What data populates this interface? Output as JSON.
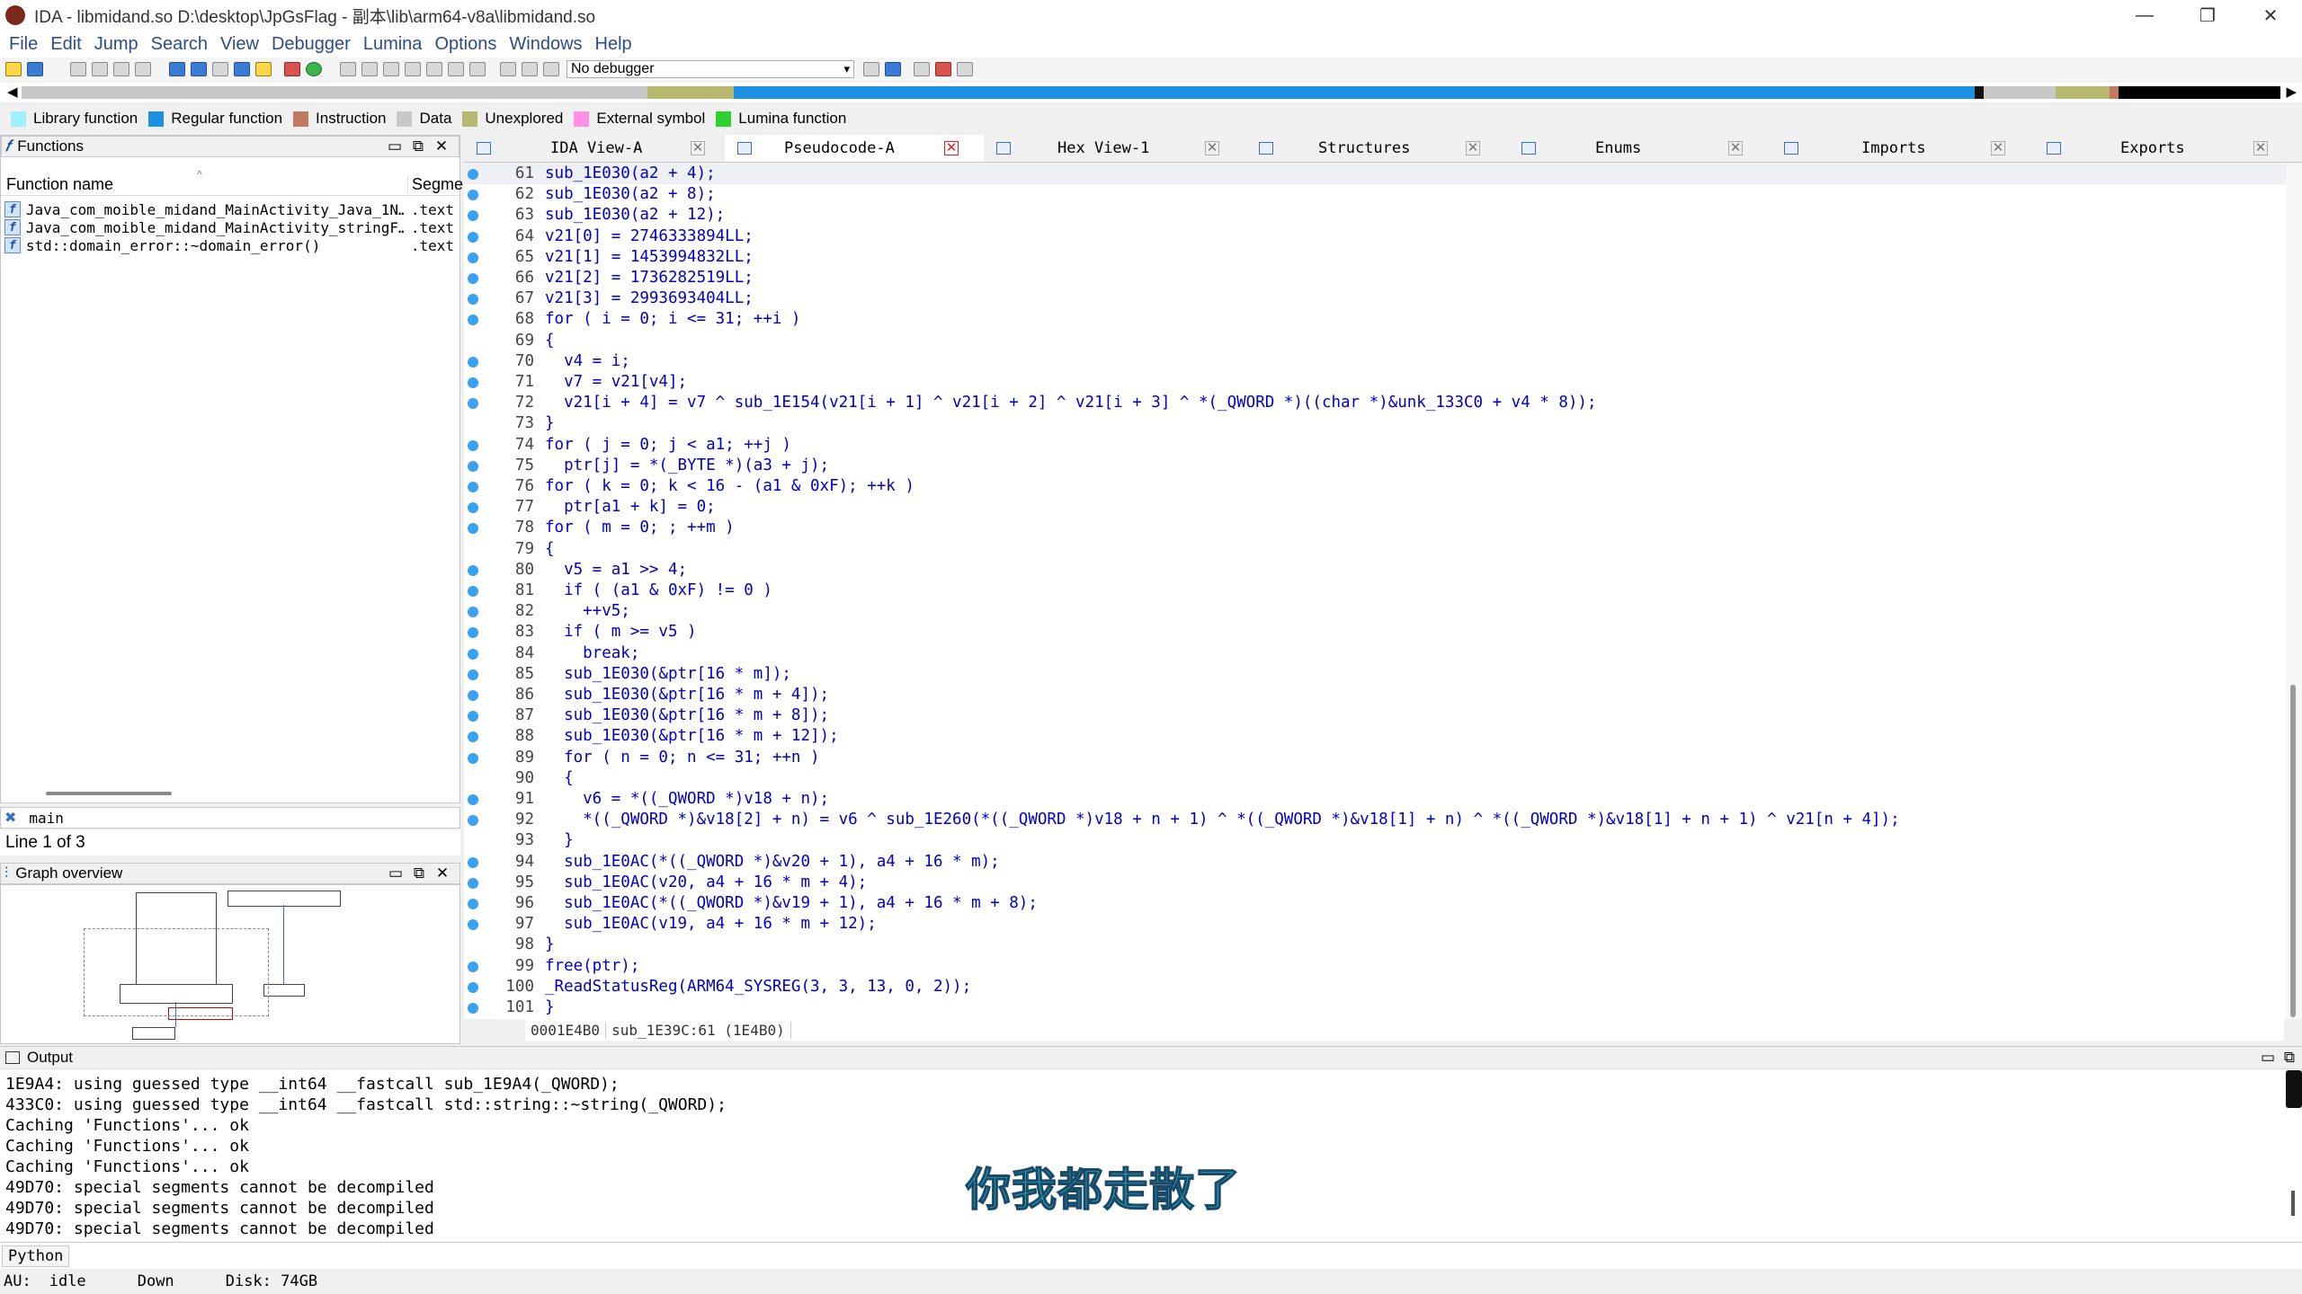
{
  "window": {
    "title": "IDA - libmidand.so D:\\desktop\\JpGsFlag - 副本\\lib\\arm64-v8a\\libmidand.so",
    "minimize": "—",
    "maximize": "❐",
    "close": "✕"
  },
  "menu": [
    "File",
    "Edit",
    "Jump",
    "Search",
    "View",
    "Debugger",
    "Lumina",
    "Options",
    "Windows",
    "Help"
  ],
  "toolbar": {
    "debugger": "No debugger"
  },
  "legend": [
    {
      "label": "Library function",
      "color": "#a0f0ff"
    },
    {
      "label": "Regular function",
      "color": "#1e90e0"
    },
    {
      "label": "Instruction",
      "color": "#c07a60"
    },
    {
      "label": "Data",
      "color": "#c8c8c8"
    },
    {
      "label": "Unexplored",
      "color": "#b8b870"
    },
    {
      "label": "External symbol",
      "color": "#ff90e8"
    },
    {
      "label": "Lumina function",
      "color": "#30d030"
    }
  ],
  "functions_panel": {
    "title": "Functions",
    "col_name": "Function name",
    "col_segment": "Segme",
    "rows": [
      {
        "name": "Java_com_moible_midand_MainActivity_Java_1N…",
        "segment": ".text"
      },
      {
        "name": "Java_com_moible_midand_MainActivity_stringF…",
        "segment": ".text"
      },
      {
        "name": "std::domain_error::~domain_error()",
        "segment": ".text"
      }
    ],
    "filter": "main",
    "line_info": "Line 1 of 3"
  },
  "graph_panel": {
    "title": "Graph overview"
  },
  "tabs": [
    {
      "label": "IDA View-A"
    },
    {
      "label": "Pseudocode-A"
    },
    {
      "label": "Hex View-1"
    },
    {
      "label": "Structures"
    },
    {
      "label": "Enums"
    },
    {
      "label": "Imports"
    },
    {
      "label": "Exports"
    }
  ],
  "code_lines": [
    {
      "n": "61",
      "text": "sub_1E030(a2 + 4);"
    },
    {
      "n": "62",
      "text": "sub_1E030(a2 + 8);"
    },
    {
      "n": "63",
      "text": "sub_1E030(a2 + 12);"
    },
    {
      "n": "64",
      "text": "v21[0] = 2746333894LL;"
    },
    {
      "n": "65",
      "text": "v21[1] = 1453994832LL;"
    },
    {
      "n": "66",
      "text": "v21[2] = 1736282519LL;"
    },
    {
      "n": "67",
      "text": "v21[3] = 2993693404LL;"
    },
    {
      "n": "68",
      "text": "for ( i = 0; i <= 31; ++i )"
    },
    {
      "n": "69",
      "text": "{"
    },
    {
      "n": "70",
      "text": "  v4 = i;"
    },
    {
      "n": "71",
      "text": "  v7 = v21[v4];"
    },
    {
      "n": "72",
      "text": "  v21[i + 4] = v7 ^ sub_1E154(v21[i + 1] ^ v21[i + 2] ^ v21[i + 3] ^ *(_QWORD *)((char *)&unk_133C0 + v4 * 8));"
    },
    {
      "n": "73",
      "text": "}"
    },
    {
      "n": "74",
      "text": "for ( j = 0; j < a1; ++j )"
    },
    {
      "n": "75",
      "text": "  ptr[j] = *(_BYTE *)(a3 + j);"
    },
    {
      "n": "76",
      "text": "for ( k = 0; k < 16 - (a1 & 0xF); ++k )"
    },
    {
      "n": "77",
      "text": "  ptr[a1 + k] = 0;"
    },
    {
      "n": "78",
      "text": "for ( m = 0; ; ++m )"
    },
    {
      "n": "79",
      "text": "{"
    },
    {
      "n": "80",
      "text": "  v5 = a1 >> 4;"
    },
    {
      "n": "81",
      "text": "  if ( (a1 & 0xF) != 0 )"
    },
    {
      "n": "82",
      "text": "    ++v5;"
    },
    {
      "n": "83",
      "text": "  if ( m >= v5 )"
    },
    {
      "n": "84",
      "text": "    break;"
    },
    {
      "n": "85",
      "text": "  sub_1E030(&ptr[16 * m]);"
    },
    {
      "n": "86",
      "text": "  sub_1E030(&ptr[16 * m + 4]);"
    },
    {
      "n": "87",
      "text": "  sub_1E030(&ptr[16 * m + 8]);"
    },
    {
      "n": "88",
      "text": "  sub_1E030(&ptr[16 * m + 12]);"
    },
    {
      "n": "89",
      "text": "  for ( n = 0; n <= 31; ++n )"
    },
    {
      "n": "90",
      "text": "  {"
    },
    {
      "n": "91",
      "text": "    v6 = *((_QWORD *)v18 + n);"
    },
    {
      "n": "92",
      "text": "    *((_QWORD *)&v18[2] + n) = v6 ^ sub_1E260(*((_QWORD *)v18 + n + 1) ^ *((_QWORD *)&v18[1] + n) ^ *((_QWORD *)&v18[1] + n + 1) ^ v21[n + 4]);"
    },
    {
      "n": "93",
      "text": "  }"
    },
    {
      "n": "94",
      "text": "  sub_1E0AC(*((_QWORD *)&v20 + 1), a4 + 16 * m);"
    },
    {
      "n": "95",
      "text": "  sub_1E0AC(v20, a4 + 16 * m + 4);"
    },
    {
      "n": "96",
      "text": "  sub_1E0AC(*((_QWORD *)&v19 + 1), a4 + 16 * m + 8);"
    },
    {
      "n": "97",
      "text": "  sub_1E0AC(v19, a4 + 16 * m + 12);"
    },
    {
      "n": "98",
      "text": "}"
    },
    {
      "n": "99",
      "text": "free(ptr);"
    },
    {
      "n": "100",
      "text": "_ReadStatusReg(ARM64_SYSREG(3, 3, 13, 0, 2));"
    },
    {
      "n": "101",
      "text": "}"
    }
  ],
  "code_status": {
    "address": "0001E4B0",
    "location": "sub_1E39C:61 (1E4B0)"
  },
  "output": {
    "title": "Output",
    "lines": [
      "1E9A4: using guessed type __int64 __fastcall sub_1E9A4(_QWORD);",
      "433C0: using guessed type __int64 __fastcall std::string::~string(_QWORD);",
      "Caching 'Functions'... ok",
      "Caching 'Functions'... ok",
      "Caching 'Functions'... ok",
      "49D70: special segments cannot be decompiled",
      "49D70: special segments cannot be decompiled",
      "49D70: special segments cannot be decompiled"
    ]
  },
  "python_label": "Python",
  "status": {
    "au": "AU:",
    "state": "idle",
    "direction": "Down",
    "disk": "Disk: 74GB"
  },
  "subtitle": "你我都走散了"
}
